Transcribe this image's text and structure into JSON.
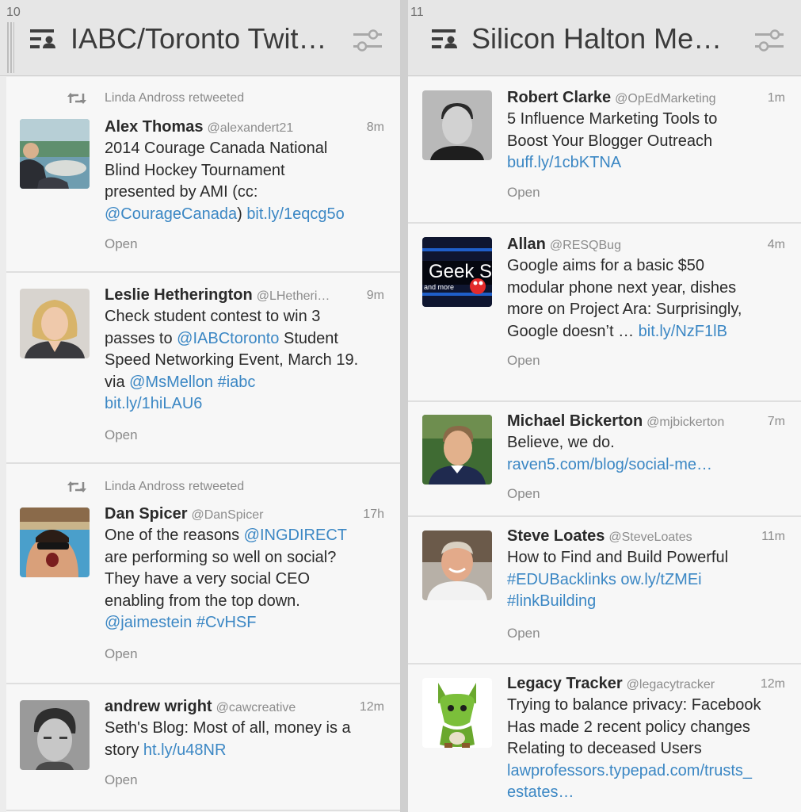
{
  "columns": [
    {
      "number": "10",
      "title": "IABC/Toronto Twit…",
      "tweets": [
        {
          "retweeted_by": "Linda Andross retweeted",
          "name": "Alex Thomas",
          "handle": "@alexandert21",
          "time": "8m",
          "text_lines": [
            [
              {
                "t": "2014 Courage Canada National"
              }
            ],
            [
              {
                "t": "Blind Hockey Tournament"
              }
            ],
            [
              {
                "t": "presented by AMI (cc:"
              }
            ],
            [
              {
                "t": "@CourageCanada",
                "link": true
              },
              {
                "t": ") "
              },
              {
                "t": "bit.ly/1eqcg5o",
                "link": true
              }
            ]
          ],
          "open_label": "Open",
          "avatar_icon": "photo-lake-avatar"
        },
        {
          "name": "Leslie Hetherington",
          "handle": "@LHetheri…",
          "time": "9m",
          "text_lines": [
            [
              {
                "t": "Check student contest to win 3"
              }
            ],
            [
              {
                "t": "passes to "
              },
              {
                "t": "@IABCtoronto",
                "link": true
              },
              {
                "t": " Student"
              }
            ],
            [
              {
                "t": "Speed Networking Event, March 19."
              }
            ],
            [
              {
                "t": "via "
              },
              {
                "t": "@MsMellon",
                "link": true
              },
              {
                "t": " "
              },
              {
                "t": "#iabc",
                "link": true
              }
            ],
            [
              {
                "t": "bit.ly/1hiLAU6",
                "link": true
              }
            ]
          ],
          "open_label": "Open",
          "avatar_icon": "woman-portrait-avatar"
        },
        {
          "retweeted_by": "Linda Andross retweeted",
          "name": "Dan Spicer",
          "handle": "@DanSpicer",
          "time": "17h",
          "text_lines": [
            [
              {
                "t": "One of the reasons "
              },
              {
                "t": "@INGDIRECT",
                "link": true
              }
            ],
            [
              {
                "t": "are performing so well on social?"
              }
            ],
            [
              {
                "t": "They have a very social CEO"
              }
            ],
            [
              {
                "t": "enabling from the top down."
              }
            ],
            [
              {
                "t": "@jaimestein",
                "link": true
              },
              {
                "t": " "
              },
              {
                "t": "#CvHSF",
                "link": true
              }
            ]
          ],
          "open_label": "Open",
          "avatar_icon": "pool-selfie-avatar"
        },
        {
          "name": "andrew wright",
          "handle": "@cawcreative",
          "time": "12m",
          "text_lines": [
            [
              {
                "t": "Seth's Blog: Most of all, money is a"
              }
            ],
            [
              {
                "t": "story "
              },
              {
                "t": "ht.ly/u48NR",
                "link": true
              }
            ]
          ],
          "open_label": "Open",
          "avatar_icon": "bw-portrait-avatar"
        }
      ]
    },
    {
      "number": "11",
      "title": "Silicon Halton Me…",
      "tweets": [
        {
          "name": "Robert Clarke",
          "handle": "@OpEdMarketing",
          "time": "1m",
          "text_lines": [
            [
              {
                "t": "5 Influence Marketing Tools to"
              }
            ],
            [
              {
                "t": "Boost Your Blogger Outreach"
              }
            ],
            [
              {
                "t": "buff.ly/1cbKTNA",
                "link": true
              }
            ]
          ],
          "open_label": "Open",
          "avatar_icon": "bw-man-avatar"
        },
        {
          "name": "Allan",
          "handle": "@RESQBug",
          "time": "4m",
          "text_lines": [
            [
              {
                "t": "Google aims for a basic $50"
              }
            ],
            [
              {
                "t": "modular phone next year, dishes"
              }
            ],
            [
              {
                "t": "more on Project Ara: Surprisingly,"
              }
            ],
            [
              {
                "t": "Google doesn’t … "
              },
              {
                "t": "bit.ly/NzF1lB",
                "link": true
              }
            ]
          ],
          "open_label": "Open",
          "avatar_icon": "geek-squad-avatar",
          "avatar_text": [
            "Geek S",
            "and more"
          ]
        },
        {
          "name": "Michael Bickerton",
          "handle": "@mjbickerton",
          "time": "7m",
          "text_lines": [
            [
              {
                "t": "Believe, we do."
              }
            ],
            [
              {
                "t": "raven5.com/blog/social-me…",
                "link": true
              }
            ]
          ],
          "open_label": "Open",
          "avatar_icon": "man-outdoor-avatar"
        },
        {
          "name": "Steve Loates",
          "handle": "@SteveLoates",
          "time": "11m",
          "text_lines": [
            [
              {
                "t": "How to Find and Build Powerful"
              }
            ],
            [
              {
                "t": "#EDUBacklinks",
                "link": true
              },
              {
                "t": " "
              },
              {
                "t": "ow.ly/tZMEi",
                "link": true
              }
            ],
            [
              {
                "t": "#linkBuilding",
                "link": true
              }
            ]
          ],
          "open_label": "Open",
          "avatar_icon": "smiling-man-avatar"
        },
        {
          "name": "Legacy Tracker",
          "handle": "@legacytracker",
          "time": "12m",
          "text_lines": [
            [
              {
                "t": "Trying to balance privacy: Facebook"
              }
            ],
            [
              {
                "t": "Has made 2 recent policy changes"
              }
            ],
            [
              {
                "t": "Relating to deceased Users"
              }
            ],
            [
              {
                "t": "lawprofessors.typepad.com/trusts_",
                "link": true
              }
            ],
            [
              {
                "t": "estates…",
                "link": true
              }
            ]
          ],
          "avatar_icon": "green-dog-avatar"
        }
      ]
    }
  ]
}
